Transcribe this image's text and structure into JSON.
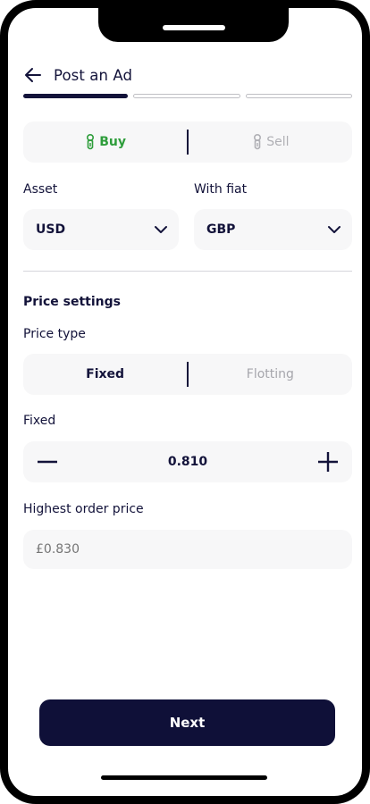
{
  "header": {
    "title": "Post an Ad"
  },
  "steps": {
    "total": 3,
    "active": 1
  },
  "trade_type": {
    "buy_label": "Buy",
    "sell_label": "Sell",
    "selected": "Buy"
  },
  "asset": {
    "label": "Asset",
    "value": "USD"
  },
  "fiat": {
    "label": "With fiat",
    "value": "GBP"
  },
  "price_settings": {
    "section_title": "Price settings",
    "price_type_label": "Price type",
    "options": [
      "Fixed",
      "Flotting"
    ],
    "selected": "Fixed"
  },
  "fixed": {
    "label": "Fixed",
    "value": "0.810"
  },
  "highest_order": {
    "label": "Highest order price",
    "placeholder": "£0.830"
  },
  "actions": {
    "next_label": "Next"
  },
  "colors": {
    "primary": "#0f1038",
    "buy_green": "#2e9d3b",
    "field_bg": "#f7f7f8"
  }
}
